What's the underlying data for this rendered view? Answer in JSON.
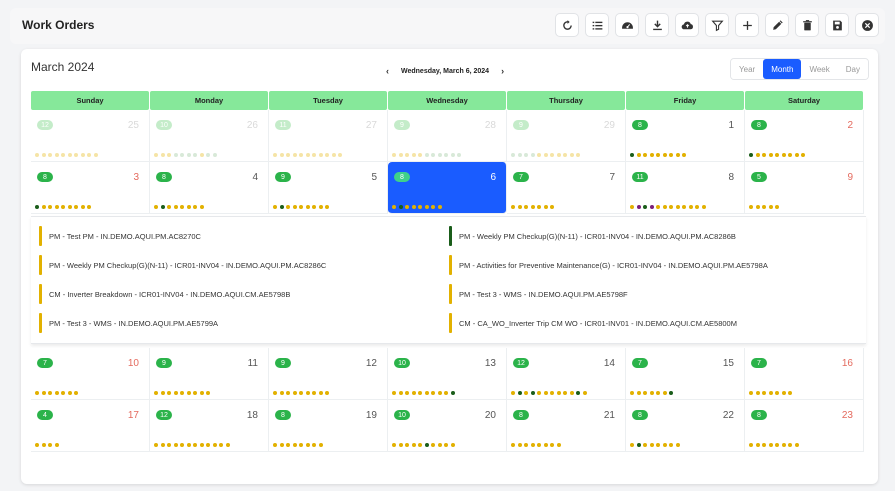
{
  "header": {
    "title": "Work Orders"
  },
  "toolbar": [
    {
      "name": "refresh-icon"
    },
    {
      "name": "list-icon"
    },
    {
      "name": "dashboard-icon"
    },
    {
      "name": "download-icon"
    },
    {
      "name": "cloud-upload-icon"
    },
    {
      "name": "filter-icon"
    },
    {
      "name": "plus-icon"
    },
    {
      "name": "edit-icon"
    },
    {
      "name": "trash-icon"
    },
    {
      "name": "save-icon"
    },
    {
      "name": "close-icon"
    }
  ],
  "calendar": {
    "month_label": "March 2024",
    "selected_date": "Wednesday, March 6, 2024",
    "prev": "‹",
    "next": "›",
    "views": [
      "Year",
      "Month",
      "Week",
      "Day"
    ],
    "active_view": "Month",
    "weekdays": [
      "Sunday",
      "Monday",
      "Tuesday",
      "Wednesday",
      "Thursday",
      "Friday",
      "Saturday"
    ],
    "colors": {
      "yellow": "#e2b100",
      "green": "#1a5d1a",
      "purple": "#7a1f7a",
      "lightgreen": "#8fbf8f"
    },
    "weeks_top": [
      [
        {
          "badge": "12",
          "day": "25",
          "other": true,
          "dots": "yyyyyyyyyy"
        },
        {
          "badge": "10",
          "day": "26",
          "other": true,
          "dots": "yyyllllyll"
        },
        {
          "badge": "11",
          "day": "27",
          "other": true,
          "dots": "yyyyyyyyyyy"
        },
        {
          "badge": "9",
          "day": "28",
          "other": true,
          "dots": "yyyyyllllll"
        },
        {
          "badge": "9",
          "day": "29",
          "other": true,
          "dots": "llllyyyyyyy"
        },
        {
          "badge": "8",
          "day": "1",
          "dots": "gyyyyyyyy"
        },
        {
          "badge": "8",
          "day": "2",
          "weekend": true,
          "dots": "gyyyyyyyy"
        }
      ],
      [
        {
          "badge": "8",
          "day": "3",
          "weekend": true,
          "dots": "gyyyyyyyy"
        },
        {
          "badge": "8",
          "day": "4",
          "dots": "ygyyyyyy"
        },
        {
          "badge": "9",
          "day": "5",
          "dots": "ygyyyyyyy"
        },
        {
          "badge": "8",
          "day": "6",
          "selected": true,
          "dots": "ygyyyyyy"
        },
        {
          "badge": "7",
          "day": "7",
          "dots": "yyyyyyy"
        },
        {
          "badge": "11",
          "day": "8",
          "dots": "ypgpyyyyyyyy"
        },
        {
          "badge": "5",
          "day": "9",
          "weekend": true,
          "dots": "yyyyy"
        }
      ]
    ],
    "details_left": [
      {
        "text": "PM - Test PM - IN.DEMO.AQUI.PM.AC8270C",
        "color": "y"
      },
      {
        "text": "PM - Weekly PM Checkup(G)(N-11) - ICR01-INV04 - IN.DEMO.AQUI.PM.AC8286C",
        "color": "y"
      },
      {
        "text": "CM - Inverter Breakdown - ICR01-INV04 - IN.DEMO.AQUI.CM.AE5798B",
        "color": "y"
      },
      {
        "text": "PM - Test 3 - WMS - IN.DEMO.AQUI.PM.AE5799A",
        "color": "y"
      }
    ],
    "details_right": [
      {
        "text": "PM - Weekly PM Checkup(G)(N-11) - ICR01-INV04 - IN.DEMO.AQUI.PM.AC8286B",
        "color": "g"
      },
      {
        "text": "PM - Activities for Preventive Maintenance(G) - ICR01-INV04 - IN.DEMO.AQUI.PM.AE5798A",
        "color": "y"
      },
      {
        "text": "PM - Test 3 - WMS - IN.DEMO.AQUI.PM.AE5798F",
        "color": "y"
      },
      {
        "text": "CM - CA_WO_Inverter Trip CM WO - ICR01-INV01 - IN.DEMO.AQUI.CM.AE5800M",
        "color": "y"
      }
    ],
    "weeks_bottom": [
      [
        {
          "badge": "7",
          "day": "10",
          "weekend": true,
          "dots": "yyyyyyy"
        },
        {
          "badge": "9",
          "day": "11",
          "dots": "yyyyyyyyy"
        },
        {
          "badge": "9",
          "day": "12",
          "dots": "yyyyyyyyy"
        },
        {
          "badge": "10",
          "day": "13",
          "dots": "yyyyyyyyyg"
        },
        {
          "badge": "12",
          "day": "14",
          "dots": "ygygyyyyyygy"
        },
        {
          "badge": "7",
          "day": "15",
          "dots": "yyyyyyg"
        },
        {
          "badge": "7",
          "day": "16",
          "weekend": true,
          "dots": "yyyyyyy"
        }
      ],
      [
        {
          "badge": "4",
          "day": "17",
          "weekend": true,
          "dots": "yyyy"
        },
        {
          "badge": "12",
          "day": "18",
          "dots": "yyyyyyyyyyyy"
        },
        {
          "badge": "8",
          "day": "19",
          "dots": "yyyyyyyy"
        },
        {
          "badge": "10",
          "day": "20",
          "dots": "yyyyygyyyy"
        },
        {
          "badge": "8",
          "day": "21",
          "dots": "yyyyyyyy"
        },
        {
          "badge": "8",
          "day": "22",
          "dots": "ygyyyyyy"
        },
        {
          "badge": "8",
          "day": "23",
          "weekend": true,
          "dots": "yyyyyyyy"
        }
      ]
    ]
  }
}
